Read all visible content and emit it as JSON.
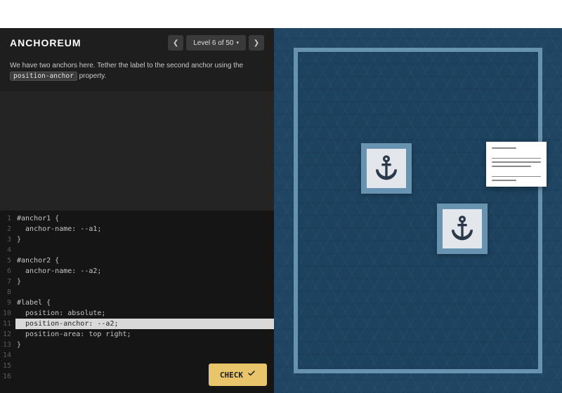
{
  "brand": "ANCHOREUM",
  "level": {
    "prev_icon": "chevron-left",
    "next_icon": "chevron-right",
    "label": "Level 6 of 50"
  },
  "instructions": {
    "text_before": "We have two anchors here. Tether the label to the second anchor using the ",
    "code_token": "position-anchor",
    "text_after": " property."
  },
  "editor": {
    "lines": [
      "#anchor1 {",
      "  anchor-name: --a1;",
      "}",
      "",
      "#anchor2 {",
      "  anchor-name: --a2;",
      "}",
      "",
      "#label {",
      "  position: absolute;",
      "  position-anchor: --a2;",
      "  position-area: top right;",
      "}",
      "",
      "",
      ""
    ],
    "highlight_line_index": 10
  },
  "check_button": "CHECK",
  "colors": {
    "accent": "#e8c46b",
    "stage_bg": "#1f4563",
    "stage_border": "#6893b0"
  }
}
